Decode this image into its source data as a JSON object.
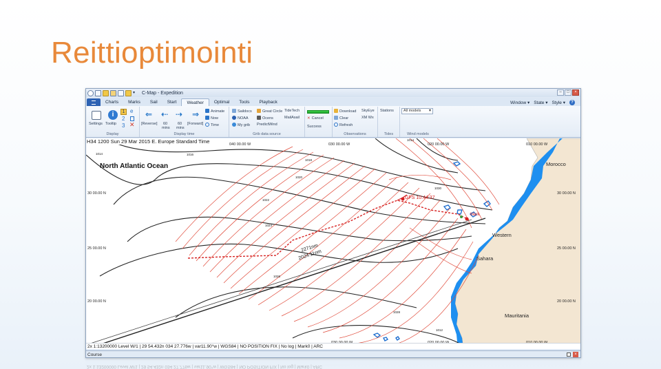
{
  "slide": {
    "title": "Reittioptimointi"
  },
  "window": {
    "title": "C-Map - Expedition",
    "quick_access_icons": [
      "app-logo-icon",
      "zoom-icon",
      "cursor-icon",
      "folder-icon",
      "ruler-icon",
      "grid-icon",
      "dropdown-icon"
    ],
    "controls": [
      "minimize-icon",
      "maximize-icon",
      "close-icon"
    ]
  },
  "menu": {
    "tabs": [
      "Charts",
      "Marks",
      "Sail",
      "Start",
      "Weather",
      "Optimal",
      "Tools",
      "Playback"
    ],
    "active_tab": "Weather",
    "right": {
      "window": "Window ▾",
      "state": "State ▾",
      "style": "Style ▾",
      "help": "?"
    }
  },
  "ribbon": {
    "display": {
      "label": "Display",
      "settings": "Settings",
      "tooltip": "Tooltip",
      "nums": [
        "1",
        "2",
        "3"
      ],
      "letter": "e"
    },
    "display_time": {
      "label": "Display time",
      "reverse": "[Reverse]",
      "back60": "60",
      "back60_unit": "mins",
      "fwd60": "60",
      "fwd60_unit": "mins",
      "forward": "[Forward]",
      "animate": "Animate",
      "now": "Now",
      "time": "Time"
    },
    "grib": {
      "label": "Grib data source",
      "saildocs": "Saildocs",
      "noaa": "NOAA",
      "mygrib": "My grib",
      "great_circle": "Great Circle",
      "ocens": "Ocens",
      "predictwind": "PredictWind",
      "tidetech": "TideTech",
      "mailasail": "MailAsail"
    },
    "status": {
      "cancel": "Cancel",
      "success": "Success"
    },
    "observations": {
      "label": "Observations",
      "download": "Download",
      "skyeye": "SkyEye",
      "clear": "Clear",
      "xmwx": "XM Wx",
      "refresh": "Refresh"
    },
    "tides": {
      "label": "Tides",
      "stations": "Stations"
    },
    "wind_models": {
      "label": "Wind models",
      "select": "All models"
    }
  },
  "map": {
    "header": "H34 1200 Sun 29 Mar 2015 E. Europe Standard Time",
    "ocean": "North Atlantic Ocean",
    "land": {
      "morocco": "Morocco",
      "western": "Western",
      "sahara": "Sahara",
      "mauritania": "Mauritania"
    },
    "lat_labels": [
      "30 00.00 N",
      "25 00.00 N",
      "20 00.00 N"
    ],
    "lat_labels_right": [
      "30 00.00 N",
      "25 00.00 N",
      "20 00.00 N"
    ],
    "lon_labels_top": [
      "040 00.00 W",
      "030 00.00 W",
      "020 00.00 W",
      "010 00.00 W"
    ],
    "lon_labels_bottom": [
      "030 00.00 W",
      "020 00.00 W",
      "010 00.00 W"
    ],
    "route_gfs": "GFS 10:44:37",
    "route_mark": "Mark",
    "route_dist": "2271nm",
    "route_dist2": "2024.11nm",
    "isobar_labels": [
      "1014",
      "1016",
      "1018",
      "1020",
      "1022",
      "1024",
      "1026",
      "1028",
      "1030",
      "1014",
      "1012"
    ],
    "colors": {
      "isochrone": "#e04a3a",
      "route": "#d62020",
      "isobar": "#222222",
      "land": "#f3e6d2",
      "water": "#1e8ff0"
    }
  },
  "statusbar": {
    "text": "2x 1:13200000 Level W/1 | 29 54.432n 034 27.776w | var11.90°w | WGS84 | NO POSITION FIX | No log | Mark0 | ARC"
  },
  "coursebar": {
    "label": "Course"
  }
}
